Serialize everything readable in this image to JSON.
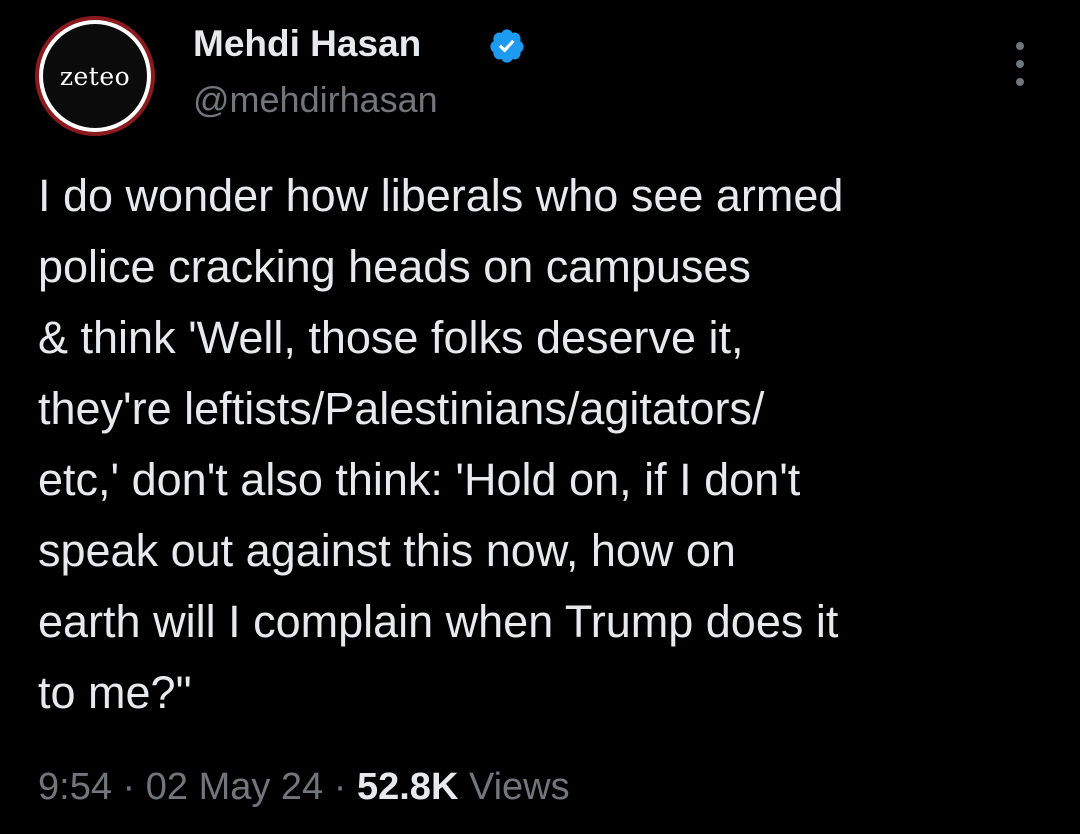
{
  "author": {
    "display_name": "Mehdi Hasan",
    "handle": "@mehdirhasan",
    "verified": true,
    "avatar_logo_text": "zeteo",
    "avatar_ring_color": "#8b1a1f",
    "verified_color": "#1d9bf0"
  },
  "tweet": {
    "lines": [
      "I do wonder how liberals who see armed",
      "police cracking heads on campuses",
      "& think 'Well, those folks deserve it,",
      "they're leftists/Palestinians/agitators/",
      "etc,' don't also think: 'Hold on, if I don't",
      "speak out against this now, how on",
      "earth will I complain when Trump does it",
      "to me?\""
    ]
  },
  "meta": {
    "time": "9:54",
    "separator": " · ",
    "date": "02 May 24",
    "views_count": "52.8K",
    "views_label": " Views"
  },
  "icons": {
    "verified": "verified-badge-icon",
    "more": "more-options-icon"
  }
}
